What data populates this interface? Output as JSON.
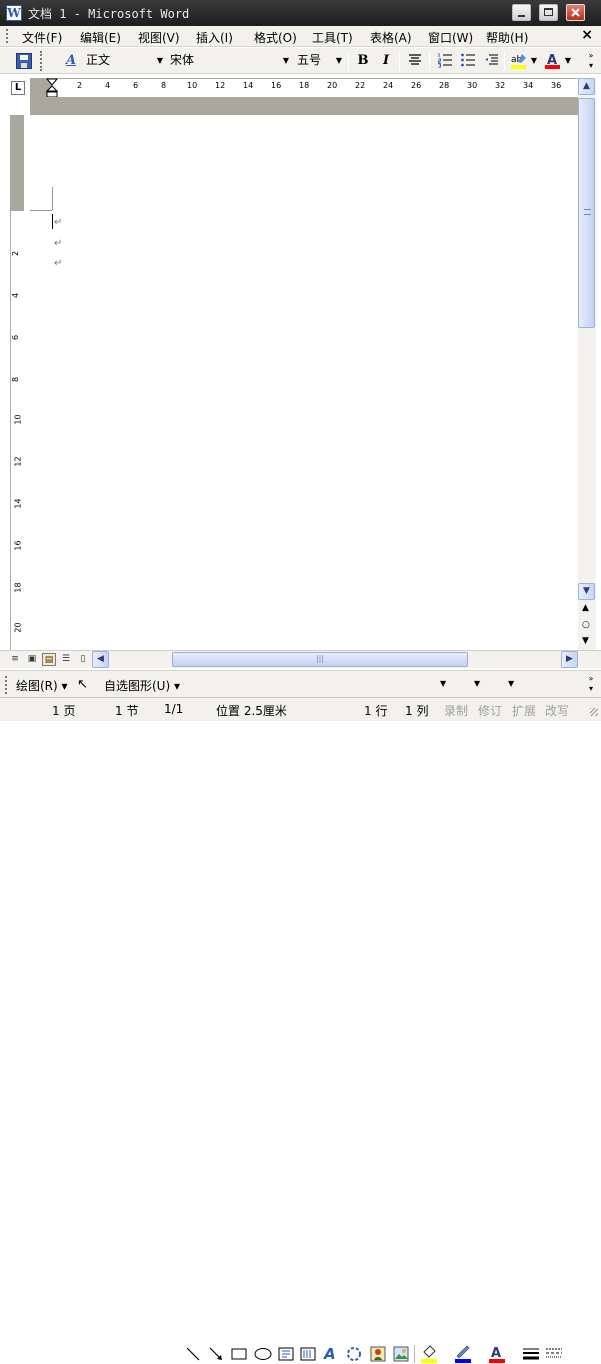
{
  "window": {
    "title": "文档 1 - Microsoft Word",
    "app_icon": "W"
  },
  "menubar": {
    "items": [
      "文件(F)",
      "编辑(E)",
      "视图(V)",
      "插入(I)",
      "格式(O)",
      "工具(T)",
      "表格(A)",
      "窗口(W)",
      "帮助(H)"
    ],
    "close_glyph": "×"
  },
  "toolbar": {
    "style_value": "正文",
    "font_value": "宋体",
    "size_value": "五号",
    "bold_label": "B",
    "italic_label": "I",
    "style_icon_label": "A"
  },
  "ruler": {
    "corner_glyph": "L",
    "h_ticks": [
      "2",
      "4",
      "6",
      "8",
      "10",
      "12",
      "14",
      "16",
      "18",
      "20",
      "22",
      "24",
      "26",
      "28",
      "30",
      "32",
      "34",
      "36"
    ],
    "v_ticks": [
      "4",
      "2",
      "2",
      "4",
      "6",
      "8",
      "10",
      "12",
      "14",
      "16",
      "18",
      "20"
    ]
  },
  "document": {
    "paragraph_mark": "↵"
  },
  "drawbar": {
    "draw_label": "绘图(R)",
    "autoshape_label": "自选图形(U)"
  },
  "status": {
    "page": "1 页",
    "section": "1 节",
    "page_of": "1/1",
    "position": "位置 2.5厘米",
    "line": "1 行",
    "column": "1 列",
    "rec": "录制",
    "trk": "修订",
    "ext": "扩展",
    "ovr": "改写"
  },
  "colors": {
    "highlight": "#ffff00",
    "font_color": "#ff0000",
    "line_color": "#0000ff"
  }
}
